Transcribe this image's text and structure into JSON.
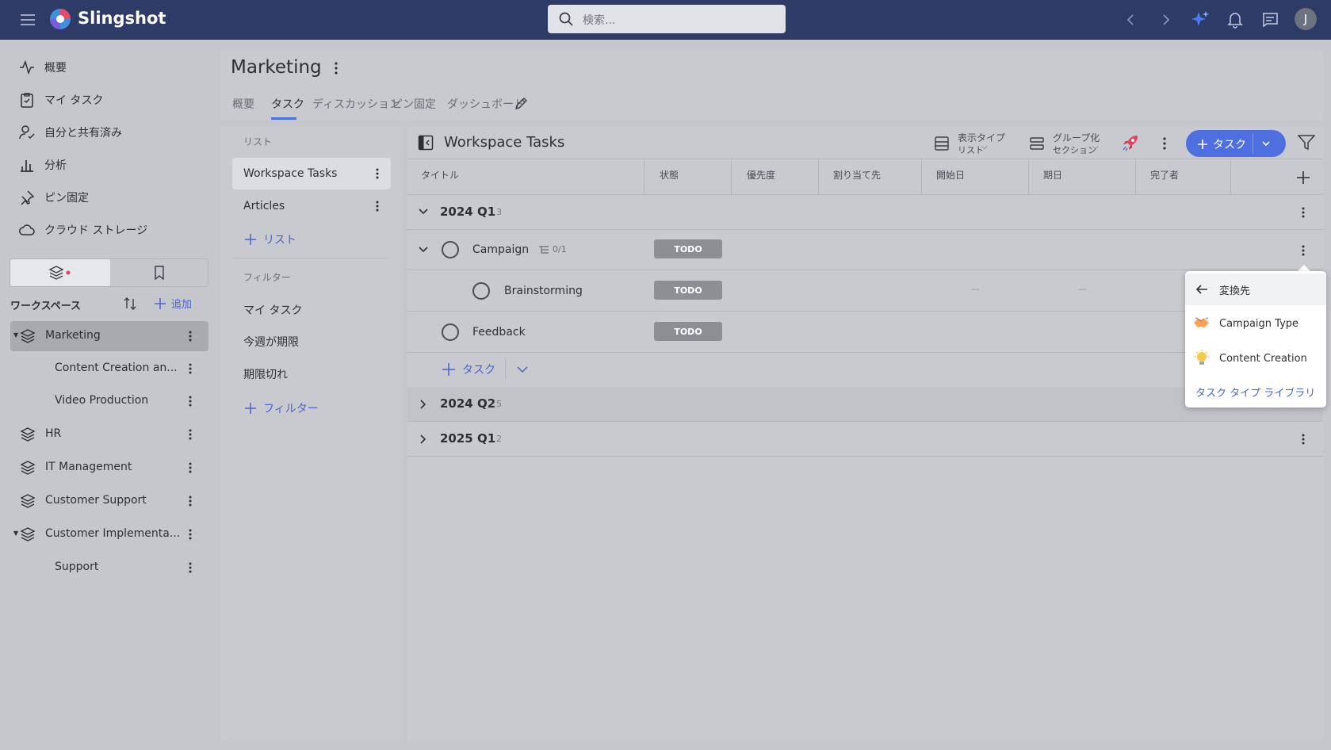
{
  "app": {
    "name": "Slingshot",
    "search_placeholder": "検索...",
    "avatar_initial": "J"
  },
  "sidebar": {
    "nav": [
      "概要",
      "マイ タスク",
      "自分と共有済み",
      "分析",
      "ピン固定",
      "クラウド ストレージ"
    ],
    "section_title": "ワークスペース",
    "add_label": "追加",
    "workspaces": [
      {
        "label": "Marketing",
        "type": "workspace",
        "expanded": true,
        "selected": true
      },
      {
        "label": "Content Creation an...",
        "type": "child"
      },
      {
        "label": "Video Production",
        "type": "child"
      },
      {
        "label": "HR",
        "type": "workspace"
      },
      {
        "label": "IT Management",
        "type": "workspace"
      },
      {
        "label": "Customer Support",
        "type": "workspace"
      },
      {
        "label": "Customer Implementa...",
        "type": "workspace",
        "expanded": true
      },
      {
        "label": "Support",
        "type": "child"
      }
    ]
  },
  "page": {
    "title": "Marketing",
    "tabs": [
      "概要",
      "タスク",
      "ディスカッション",
      "ピン固定",
      "ダッシュボード"
    ],
    "active_tab": "タスク"
  },
  "lists_panel": {
    "lists_header": "リスト",
    "lists": [
      "Workspace Tasks",
      "Articles"
    ],
    "add_list": "リスト",
    "filters_header": "フィルター",
    "filters": [
      "マイ タスク",
      "今週が期限",
      "期限切れ"
    ],
    "add_filter": "フィルター"
  },
  "tasks": {
    "title": "Workspace Tasks",
    "view_type_label": "表示タイプ",
    "view_type_value": "リスト",
    "group_label": "グループ化",
    "group_value": "セクション",
    "add_task": "タスク",
    "columns": [
      "タイトル",
      "状態",
      "優先度",
      "割り当て先",
      "開始日",
      "期日",
      "完了者"
    ],
    "groups": [
      {
        "name": "2024 Q1",
        "count": "3",
        "expanded": true
      },
      {
        "name": "2024 Q2",
        "count": "5"
      },
      {
        "name": "2025 Q1",
        "count": "2"
      }
    ],
    "rows": [
      {
        "title": "Campaign",
        "subtasks": "0/1",
        "status": "TODO"
      },
      {
        "title": "Brainstorming",
        "status": "TODO",
        "start": "—",
        "due": "—"
      },
      {
        "title": "Feedback",
        "status": "TODO"
      }
    ],
    "add_task_inline": "タスク"
  },
  "convert_menu": {
    "header": "変換先",
    "items": [
      "Campaign Type",
      "Content Creation"
    ],
    "library_link": "タスク タイプ ライブラリ"
  },
  "colors": {
    "topbar": "#2f3b67",
    "accent": "#4e6fe0",
    "link": "#4b63c9",
    "todo_badge": "#8e8f95"
  }
}
